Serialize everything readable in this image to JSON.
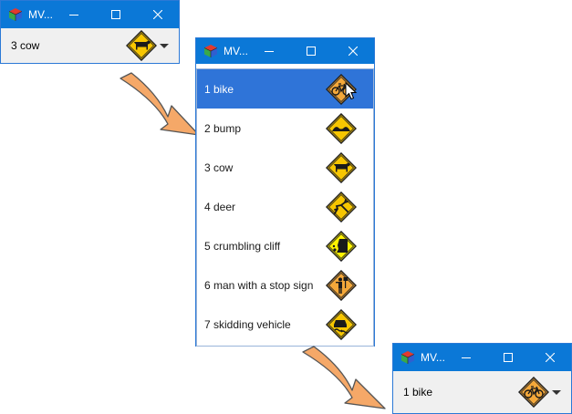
{
  "window_top": {
    "title": "MV...",
    "selected": "3 cow",
    "sign_icon": "cow-sign-icon"
  },
  "window_list": {
    "title": "MV...",
    "items": [
      {
        "label": "1 bike",
        "icon": "bike-sign-icon",
        "selected": true
      },
      {
        "label": "2 bump",
        "icon": "bump-sign-icon",
        "selected": false
      },
      {
        "label": "3 cow",
        "icon": "cow-sign-icon",
        "selected": false
      },
      {
        "label": "4 deer",
        "icon": "deer-sign-icon",
        "selected": false
      },
      {
        "label": "5 crumbling cliff",
        "icon": "crumbling-cliff-sign-icon",
        "selected": false
      },
      {
        "label": "6 man with a stop sign",
        "icon": "man-with-stop-sign-icon",
        "selected": false
      },
      {
        "label": "7 skidding vehicle",
        "icon": "skidding-vehicle-sign-icon",
        "selected": false
      }
    ]
  },
  "window_bottom": {
    "title": "MV...",
    "selected": "1 bike",
    "sign_icon": "bike-sign-icon"
  },
  "colors": {
    "titlebar": "#0b78d7",
    "selection": "#2f74d8",
    "sign_yellow": "#f7c600",
    "sign_orange": "#f4a83a",
    "arrow_fill": "#f5a868"
  }
}
